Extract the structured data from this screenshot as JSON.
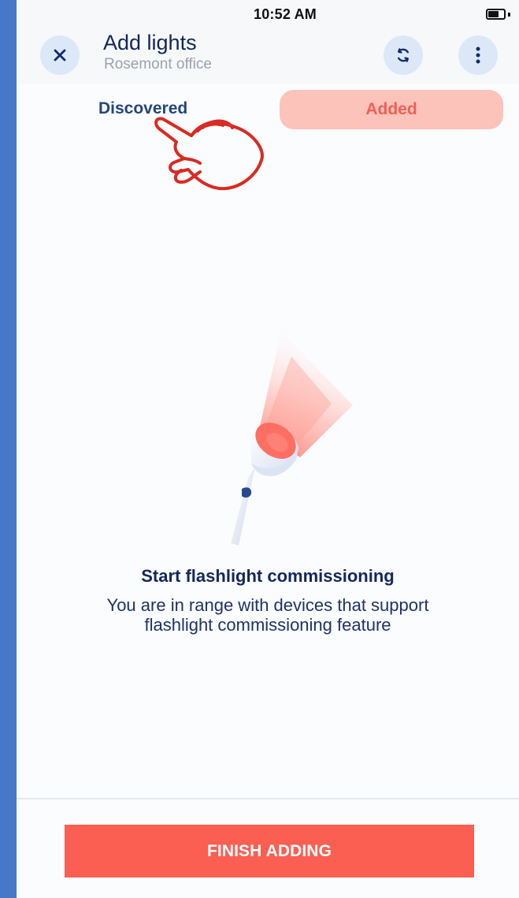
{
  "status_bar": {
    "time": "10:52 AM"
  },
  "header": {
    "title": "Add lights",
    "subtitle": "Rosemont office"
  },
  "tabs": [
    {
      "label": "Discovered"
    },
    {
      "label": "Added"
    }
  ],
  "content": {
    "heading": "Start flashlight commissioning",
    "description": "You are in range with devices that support\nflashlight commissioning feature"
  },
  "footer": {
    "button_label": "FINISH ADDING"
  },
  "icons": {
    "close": "close-icon",
    "sync": "sync-icon",
    "more": "more-vertical-icon",
    "battery": "battery-icon",
    "annotation": "pointing-hand-icon",
    "illustration": "flashlight-illustration"
  },
  "colors": {
    "brand_navy": "#12265c",
    "accent_coral": "#fa5f51",
    "tab_active_bg": "#fcc3bb",
    "background": "#fbfcfd",
    "left_strip": "#4677c8"
  }
}
